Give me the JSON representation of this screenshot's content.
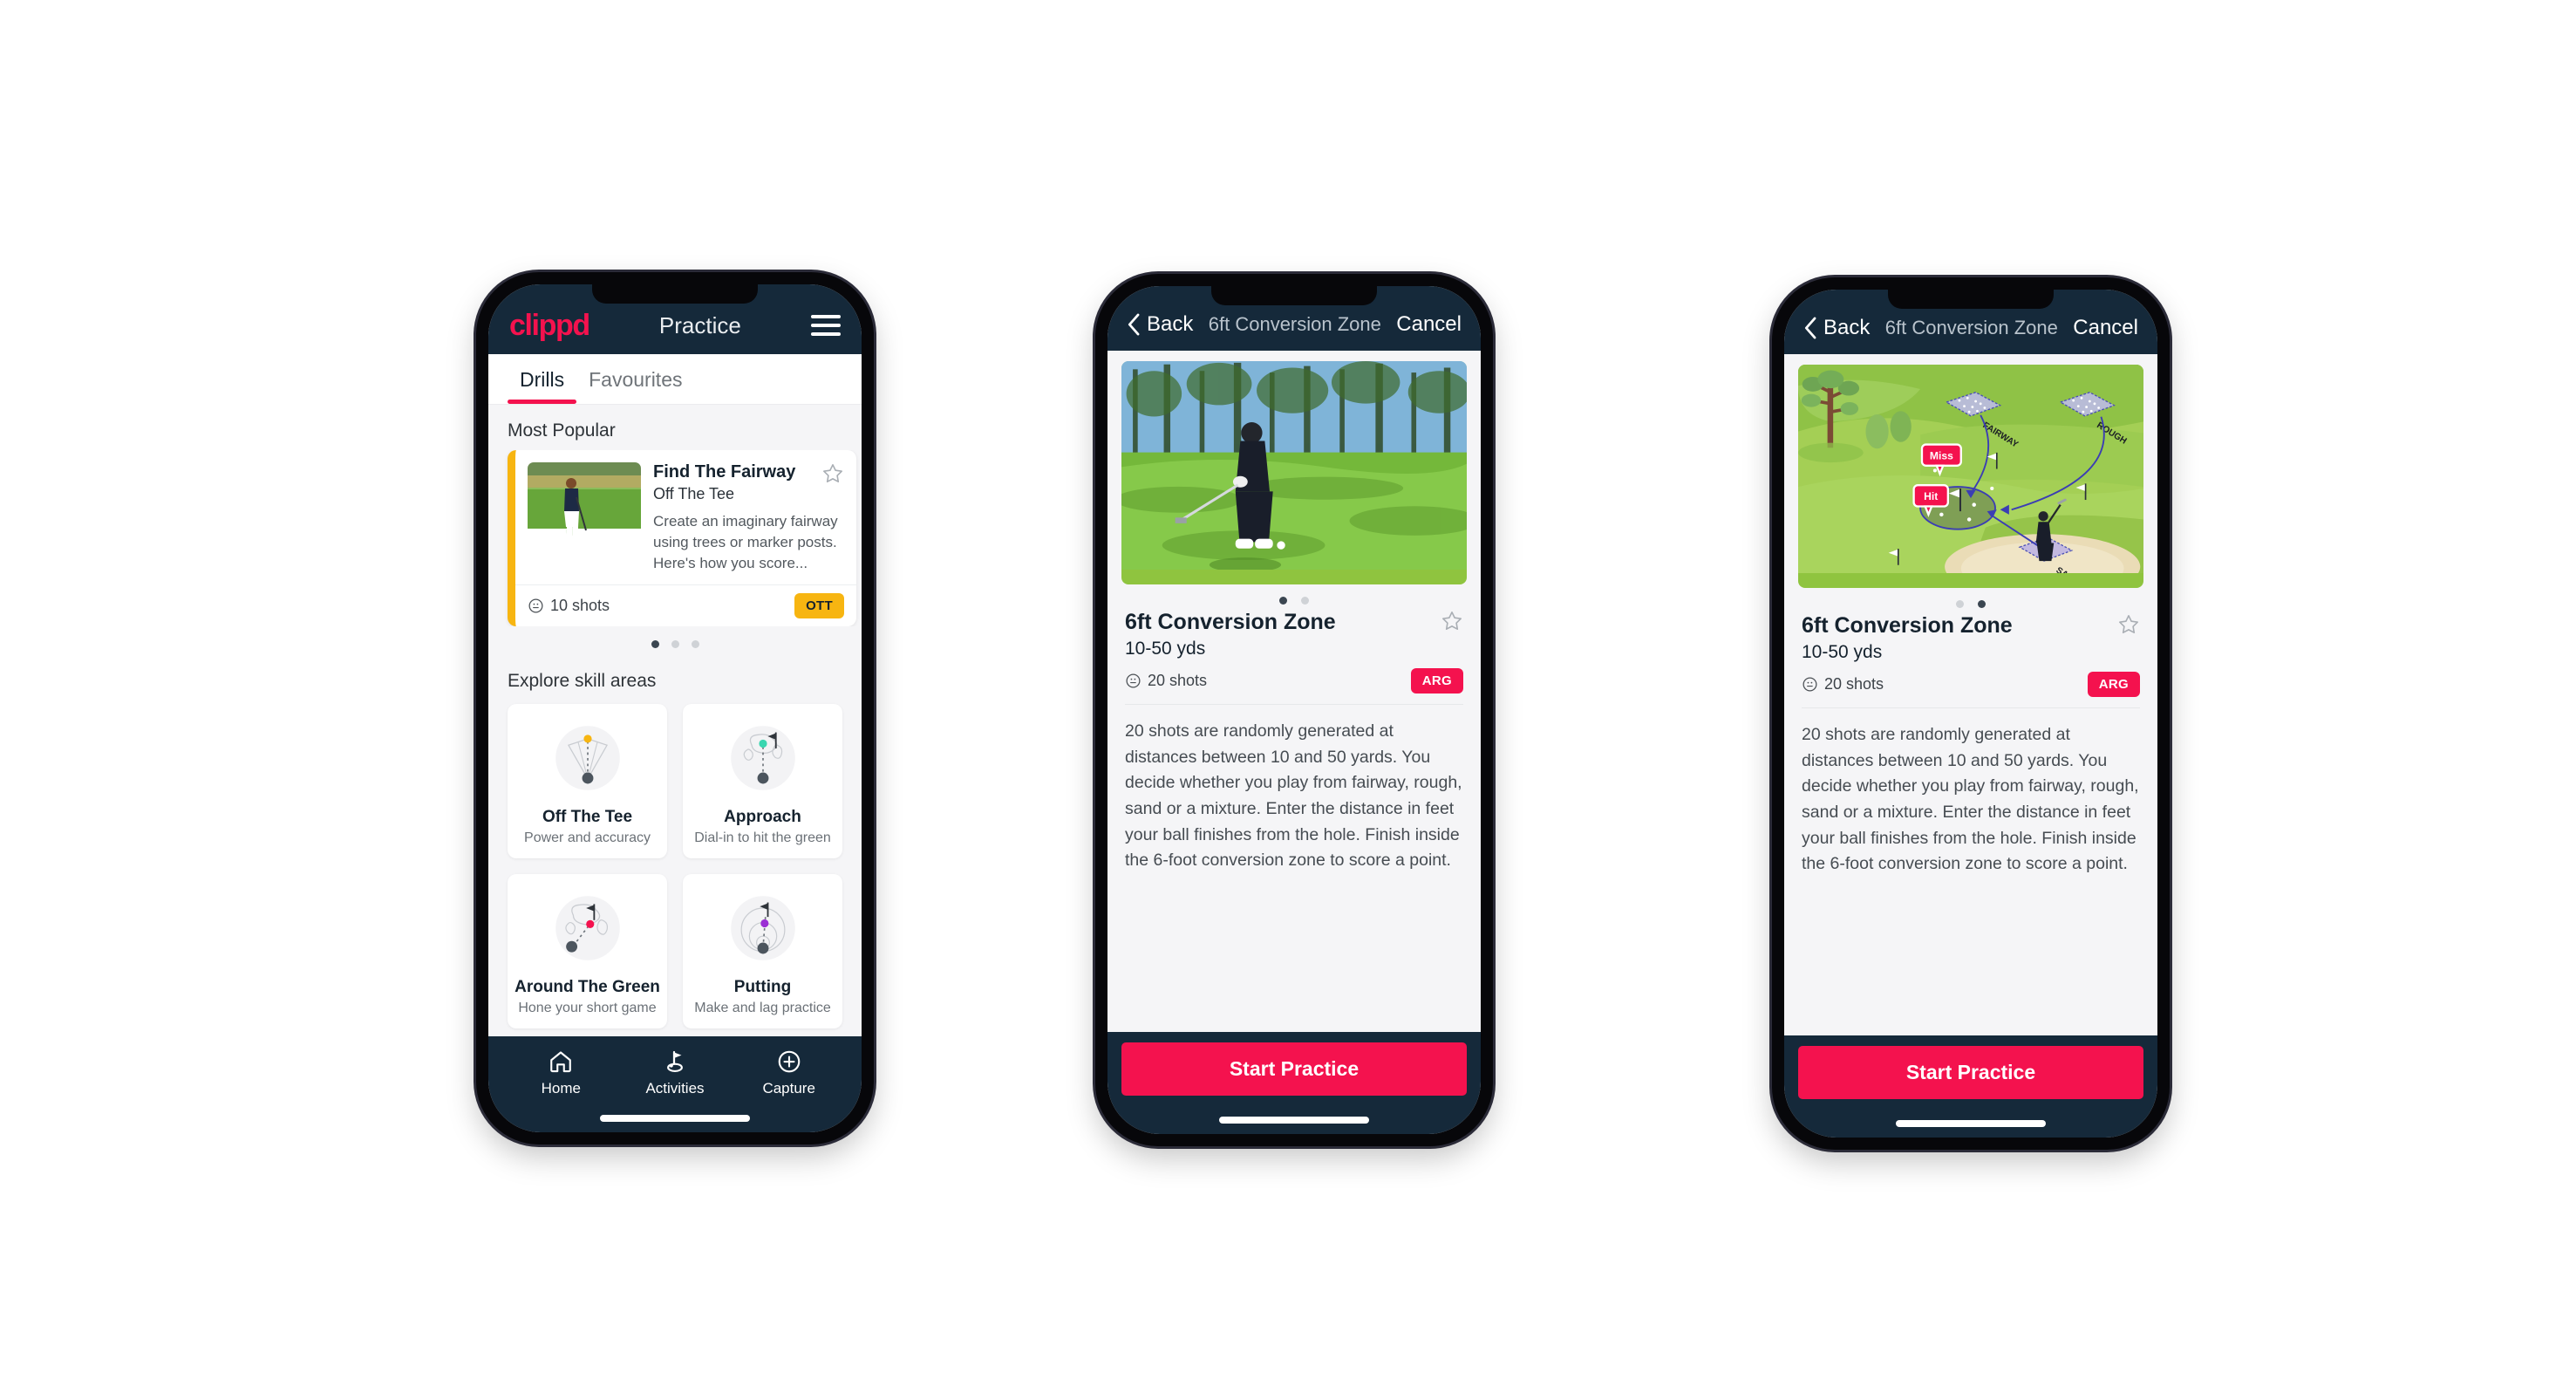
{
  "phone1": {
    "navbar": {
      "brand": "clippd",
      "title": "Practice",
      "menu_icon": "hamburger-icon"
    },
    "tabs": [
      {
        "label": "Drills",
        "active": true
      },
      {
        "label": "Favourites",
        "active": false
      }
    ],
    "most_popular_label": "Most Popular",
    "drill_card": {
      "title": "Find The Fairway",
      "subtitle": "Off The Tee",
      "description": "Create an imaginary fairway using trees or marker posts. Here's how you score...",
      "shots": "10 shots",
      "badge": "OTT",
      "badge_color": "#f7b511",
      "accent_color": "#f7b511",
      "next_accent_color": "#3ad6b0",
      "star_icon": "star-outline-icon",
      "clock_icon": "clock-icon"
    },
    "carousel_dots": {
      "count": 3,
      "active_index": 0
    },
    "explore_label": "Explore skill areas",
    "skills": [
      {
        "name": "Off The Tee",
        "desc": "Power and accuracy",
        "icon": "tee-fan-icon",
        "dot_color": "#f7b511"
      },
      {
        "name": "Approach",
        "desc": "Dial-in to hit the green",
        "icon": "approach-green-icon",
        "dot_color": "#3ad6b0"
      },
      {
        "name": "Around The Green",
        "desc": "Hone your short game",
        "icon": "around-green-icon",
        "dot_color": "#f4124e"
      },
      {
        "name": "Putting",
        "desc": "Make and lag practice",
        "icon": "putting-rings-icon",
        "dot_color": "#9b2fd4"
      }
    ],
    "bottom_nav": [
      {
        "label": "Home",
        "icon": "home-icon",
        "active": false
      },
      {
        "label": "Activities",
        "icon": "golf-flag-icon",
        "active": true
      },
      {
        "label": "Capture",
        "icon": "plus-circle-icon",
        "active": false
      }
    ]
  },
  "phone2": {
    "navbar": {
      "back": "Back",
      "title": "6ft Conversion Zone",
      "cancel": "Cancel",
      "back_icon": "chevron-left-icon"
    },
    "media_kind": "golf-video-thumbnail",
    "carousel_dots": {
      "count": 2,
      "active_index": 0
    },
    "title": "6ft Conversion Zone",
    "subtitle": "10-50 yds",
    "shots": "20 shots",
    "badge": "ARG",
    "badge_color": "#f4124e",
    "star_icon": "star-outline-icon",
    "clock_icon": "clock-icon",
    "description": "20 shots are randomly generated at distances between 10 and 50 yards. You decide whether you play from fairway, rough, sand or a mixture. Enter the distance in feet your ball finishes from the hole. Finish inside the 6-foot conversion zone to score a point.",
    "cta": "Start Practice",
    "cta_color": "#f4124e"
  },
  "phone3": {
    "navbar": {
      "back": "Back",
      "title": "6ft Conversion Zone",
      "cancel": "Cancel",
      "back_icon": "chevron-left-icon"
    },
    "media_kind": "golf-course-diagram",
    "diagram": {
      "labels": [
        "FAIRWAY",
        "ROUGH",
        "SAND"
      ],
      "callouts": [
        {
          "text": "Miss",
          "color": "#f4124e"
        },
        {
          "text": "Hit",
          "color": "#f4124e"
        }
      ]
    },
    "carousel_dots": {
      "count": 2,
      "active_index": 1
    },
    "title": "6ft Conversion Zone",
    "subtitle": "10-50 yds",
    "shots": "20 shots",
    "badge": "ARG",
    "badge_color": "#f4124e",
    "star_icon": "star-outline-icon",
    "clock_icon": "clock-icon",
    "description": "20 shots are randomly generated at distances between 10 and 50 yards. You decide whether you play from fairway, rough, sand or a mixture. Enter the distance in feet your ball finishes from the hole. Finish inside the 6-foot conversion zone to score a point.",
    "cta": "Start Practice",
    "cta_color": "#f4124e"
  }
}
